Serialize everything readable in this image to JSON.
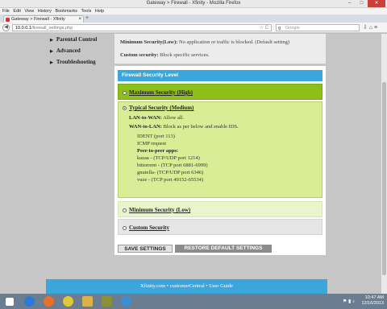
{
  "window": {
    "title": "Gateway > Firewall - Xfinity - Mozilla Firefox",
    "minimize": "–",
    "maximize": "□",
    "close": "✕"
  },
  "menu": [
    "File",
    "Edit",
    "View",
    "History",
    "Bookmarks",
    "Tools",
    "Help"
  ],
  "tab": {
    "label": "Gateway > Firewall - Xfinity",
    "close": "×",
    "new": "+"
  },
  "address": {
    "host": "10.0.0.1",
    "path": "/firewall_settings.php",
    "star": "☆",
    "reload": "C"
  },
  "search": {
    "placeholder": "Google",
    "engine_glyph": "g"
  },
  "sidebar": {
    "items": [
      "Parental Control",
      "Advanced",
      "Troubleshooting"
    ]
  },
  "top_panel": {
    "min_label": "Minimum Security(Low):",
    "min_text": "No application or traffic is blocked. (Default setting)",
    "custom_label": "Custom security:",
    "custom_text": "Block specific services."
  },
  "firewall": {
    "header": "Firewall Security Level",
    "options": {
      "maximum": "Maximum Security (High)",
      "typical": "Typical Security (Medium)",
      "minimum": "Minimum Security (Low)",
      "custom": "Custom Security"
    },
    "typical_details": {
      "lan_label": "LAN-to-WAN:",
      "lan_value": "Allow all.",
      "wan_label": "WAN-to-LAN:",
      "wan_value": "Block as per below and enable IDS.",
      "ident": "IDENT (port 113)",
      "icmp": "ICMP request",
      "p2p_label": "Peer-to-peer apps:",
      "apps": [
        "kazaa - (TCP/UDP port 1214)",
        "bittorrent - (TCP port 6881-6999)",
        "gnutella- (TCP/UDP port 6346)",
        "vuze - (TCP port 49152-65534)"
      ]
    },
    "save_button": "SAVE SETTINGS",
    "restore_button": "RESTORE DEFAULT SETTINGS"
  },
  "footer": {
    "text": "Xfinity.com • customerCentral • User Guide"
  },
  "taskbar": {
    "time": "10:47 AM",
    "date": "12/16/2013",
    "apps": [
      "ie-icon",
      "firefox-icon",
      "chrome-icon",
      "explorer-icon",
      "app-icon",
      "settings-icon"
    ]
  },
  "colors": {
    "accent": "#3aa6dc",
    "max_option": "#8dbe1a",
    "typical_option": "#d8ed96",
    "min_option": "#eaf5cc"
  }
}
